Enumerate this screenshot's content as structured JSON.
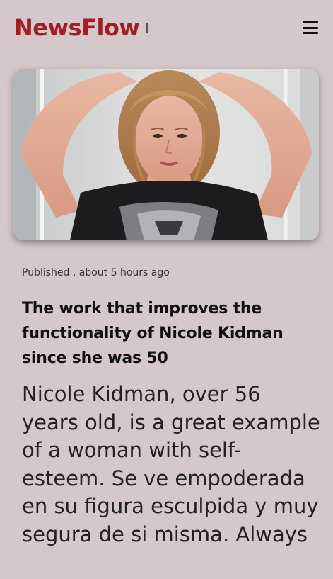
{
  "header": {
    "logo": "NewsFlow",
    "menu_icon": "hamburger-menu-icon"
  },
  "article": {
    "image_alt": "Nicole Kidman",
    "published": "Published . about 5 hours ago",
    "title": "The work that improves the functionality of Nicole Kidman since she was 50",
    "body": "Nicole Kidman, over 56 years old, is a great example of a woman with self-esteem. Se ve empoderada en su figura esculpida y muy segura de si misma. Always"
  },
  "colors": {
    "brand": "#a31e24",
    "background": "#d5c8cb"
  }
}
